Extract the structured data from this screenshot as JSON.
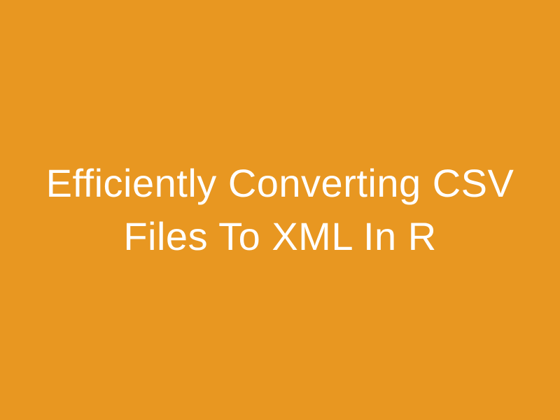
{
  "title": {
    "text": "Efficiently Converting CSV Files To XML In R"
  },
  "colors": {
    "background": "#e89721",
    "text": "#ffffff"
  }
}
